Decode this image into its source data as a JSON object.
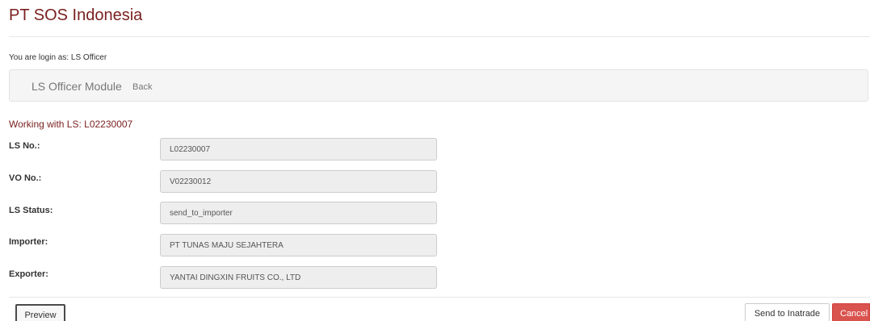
{
  "app": {
    "title": "PT SOS Indonesia"
  },
  "session": {
    "login_text": "You are login as: LS Officer"
  },
  "module": {
    "name": "LS Officer Module",
    "back_label": "Back"
  },
  "context": {
    "working_text": "Working with LS: L02230007"
  },
  "fields": [
    {
      "label": "LS No.:",
      "value": "L02230007"
    },
    {
      "label": "VO No.:",
      "value": "V02230012"
    },
    {
      "label": "LS Status:",
      "value": "send_to_importer"
    },
    {
      "label": "Importer:",
      "value": "PT TUNAS MAJU SEJAHTERA"
    },
    {
      "label": "Exporter:",
      "value": "YANTAI DINGXIN FRUITS CO., LTD"
    }
  ],
  "actions": {
    "preview_label": "Preview",
    "send_label": "Send to Inatrade",
    "cancel_label": "Cancel"
  },
  "colors": {
    "brand": "#7a1f1f",
    "danger": "#d9534f"
  }
}
